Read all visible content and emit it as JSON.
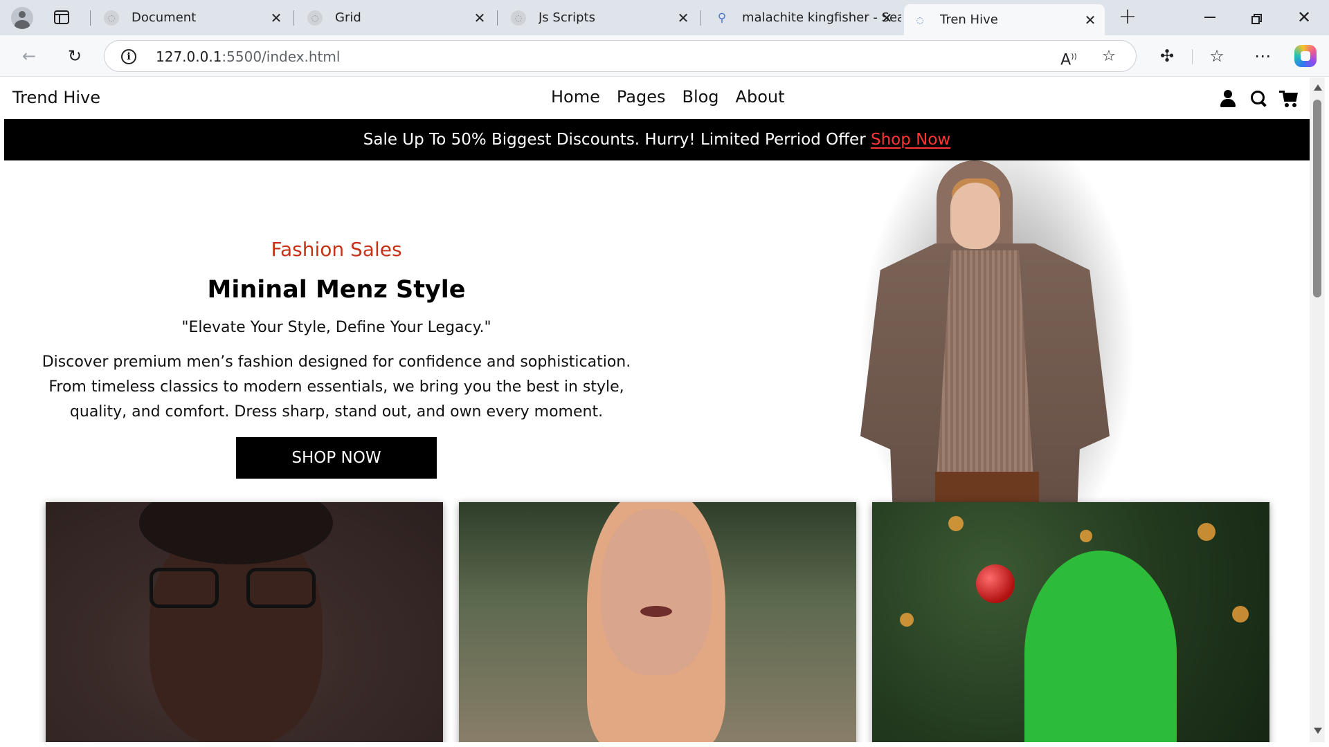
{
  "browser": {
    "tabs": [
      {
        "title": "Document",
        "favicon": "loading-favicon",
        "active": false
      },
      {
        "title": "Grid",
        "favicon": "loading-favicon",
        "active": false
      },
      {
        "title": "Js Scripts",
        "favicon": "loading-favicon",
        "active": false
      },
      {
        "title": "malachite kingfisher - Sea",
        "favicon": "search-favicon",
        "active": false
      },
      {
        "title": "Tren Hive",
        "favicon": "loading-favicon",
        "active": true
      }
    ],
    "url_host": "127.0.0.1",
    "url_rest": ":5500/index.html",
    "icons": {
      "back": "arrow-left-icon",
      "reload": "reload-icon",
      "read_aloud": "read-aloud-icon",
      "favorite": "star-icon",
      "extensions": "puzzle-icon",
      "favorites": "favorites-icon",
      "more": "more-icon",
      "copilot": "copilot-icon"
    }
  },
  "site": {
    "brand": "Trend Hive",
    "nav": [
      {
        "label": "Home"
      },
      {
        "label": "Pages"
      },
      {
        "label": "Blog"
      },
      {
        "label": "About"
      }
    ],
    "icons": [
      "user-icon",
      "search-icon",
      "cart-icon"
    ],
    "promo": {
      "text": "Sale Up To 50% Biggest Discounts. Hurry! Limited Perriod Offer ",
      "link": "Shop Now",
      "link_color": "#ff3535"
    },
    "hero": {
      "eyebrow": "Fashion Sales",
      "eyebrow_color": "#c33318",
      "title": "Mininal Menz Style",
      "tagline": "\"Elevate Your Style, Define Your Legacy.\"",
      "description": "Discover premium men’s fashion designed for confidence and sophistication. From timeless classics to modern essentials, we bring you the best in style, quality, and comfort. Dress sharp, stand out, and own every moment.",
      "button": "SHOP NOW"
    },
    "cards": [
      {
        "image": "man-with-glasses-photo"
      },
      {
        "image": "woman-portrait-photo"
      },
      {
        "image": "christmas-hat-photo"
      }
    ]
  }
}
